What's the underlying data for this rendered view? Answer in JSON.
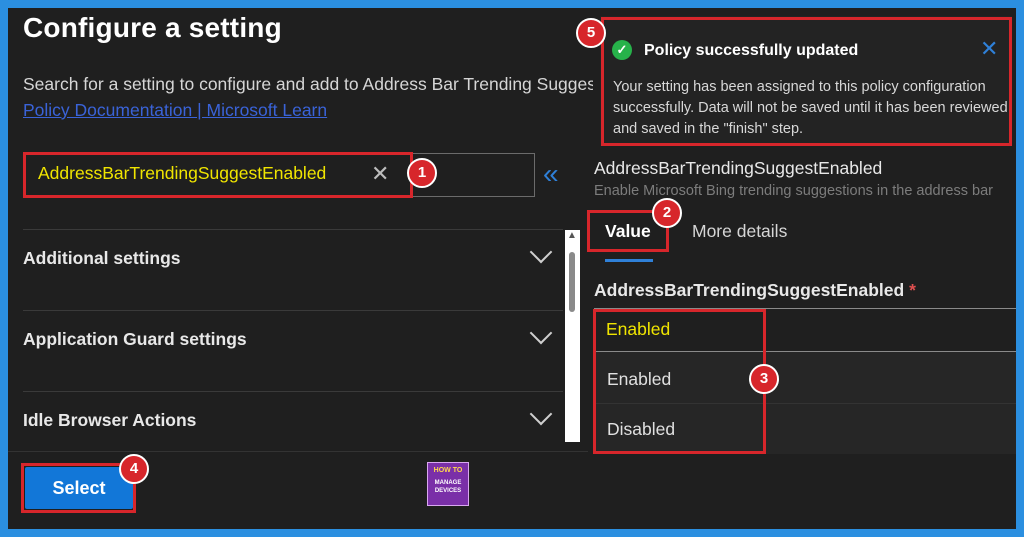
{
  "panel": {
    "title": "Configure a setting",
    "description": "Search for a setting to configure and add to Address Bar Trending Suggest",
    "doc_link": "Policy Documentation | Microsoft Learn"
  },
  "search": {
    "value": "AddressBarTrendingSuggestEnabled",
    "clear_icon": "✕"
  },
  "collapse_icon": "«",
  "accordion": [
    {
      "label": "Additional settings"
    },
    {
      "label": "Application Guard settings"
    },
    {
      "label": "Idle Browser Actions"
    }
  ],
  "footer": {
    "select_label": "Select"
  },
  "logo": {
    "line1": "HOW TO",
    "line2": "MANAGE",
    "line3": "DEVICES"
  },
  "detail": {
    "setting_name": "AddressBarTrendingSuggestEnabled",
    "setting_description": "Enable Microsoft Bing trending suggestions in the address bar",
    "tabs": [
      {
        "label": "Value"
      },
      {
        "label": "More details"
      }
    ],
    "field_label": "AddressBarTrendingSuggestEnabled",
    "required_mark": "*",
    "selected_value": "Enabled",
    "options": [
      "Enabled",
      "Disabled"
    ]
  },
  "toast": {
    "title": "Policy successfully updated",
    "body": "Your setting has been assigned to this policy configuration successfully. Data will not be saved until it has been reviewed and saved in the \"finish\" step.",
    "check_icon": "✓",
    "close_icon": "✕"
  },
  "annotations": {
    "b1": "1",
    "b2": "2",
    "b3": "3",
    "b4": "4",
    "b5": "5"
  },
  "colors": {
    "accent": "#1277d8",
    "highlight": "#f0e500",
    "annotation": "#d7262b",
    "success": "#27b24a",
    "frame": "#2b8fe0"
  }
}
